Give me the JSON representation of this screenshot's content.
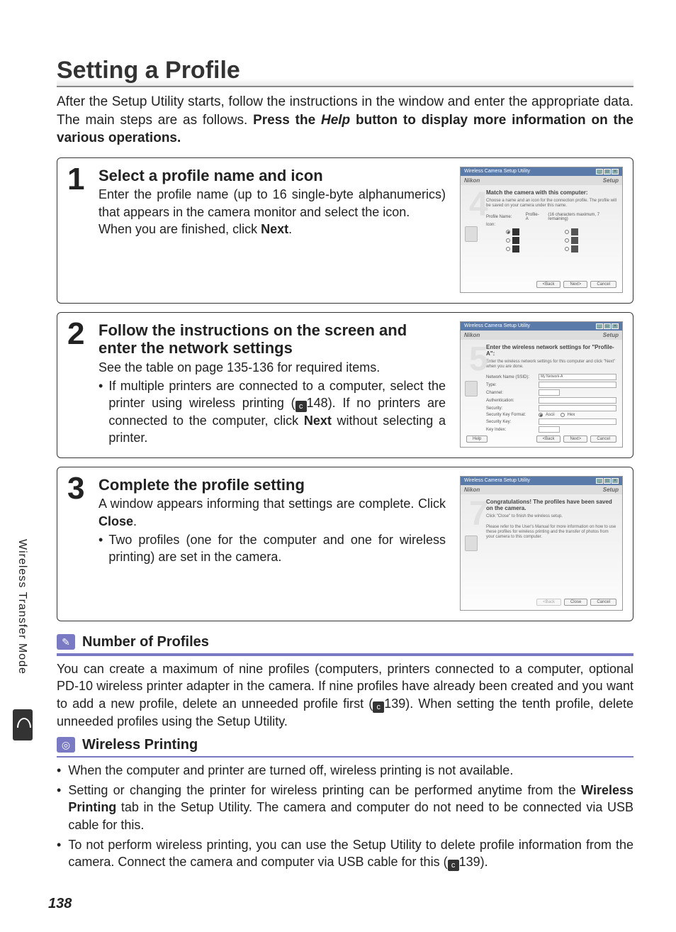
{
  "page_number": "138",
  "side_tab": "Wireless Transfer Mode",
  "heading": "Setting a Profile",
  "intro_parts": {
    "a": "After the Setup Utility starts, follow the instructions in the window and enter the appropriate data. The main steps are as follows. ",
    "b": "Press the ",
    "c": "Help",
    "d": " button to display more information on the various operations."
  },
  "steps": [
    {
      "num": "1",
      "title": "Select a profile name and icon",
      "body_a": "Enter the profile name (up to 16 single-byte alphanumerics) that appears in the camera monitor and select the icon.",
      "body_b": "When you are finished, click ",
      "body_c": "Next",
      "body_d": ".",
      "shot": {
        "bignum": "4",
        "heading": "Match the camera with this computer:",
        "sub": "Choose a name and an icon for the connection profile. The profile will be saved on your camera under this name.",
        "profile_label": "Profile Name:",
        "profile_value": "Profile-A",
        "profile_hint": "(16 characters maximum, 7 remaining)",
        "icon_label": "Icon:",
        "btn_back": "<Back",
        "btn_next": "Next>",
        "btn_cancel": "Cancel"
      }
    },
    {
      "num": "2",
      "title": "Follow the instructions on the screen and enter the network settings",
      "body_a": "See the table on page 135-136 for required items.",
      "bullet_a": "If multiple printers are connected to a computer, select the printer using wireless printing (",
      "bullet_ref": "c",
      "bullet_pg": "148). If no printers are connected to the computer, click ",
      "bullet_b": "Next",
      "bullet_c": " without selecting a printer.",
      "shot": {
        "bignum": "5",
        "heading": "Enter the wireless network settings for \"Profile-A\":",
        "sub": "Enter the wireless network settings for this computer and click \"Next\" when you are done.",
        "rows": {
          "ssid_l": "Network Name (SSID):",
          "ssid_v": "My Network-A",
          "type_l": "Type:",
          "chan_l": "Channel:",
          "auth_l": "Authentication:",
          "sec_l": "Security:",
          "fmt_l": "Security Key Format:",
          "fmt_a": "Ascii",
          "fmt_b": "Hex",
          "key_l": "Security Key:",
          "idx_l": "Key Index:"
        },
        "btn_help": "Help",
        "btn_back": "<Back",
        "btn_next": "Next>",
        "btn_cancel": "Cancel"
      }
    },
    {
      "num": "3",
      "title": "Complete the profile setting",
      "body_a": "A window appears informing that settings are complete. Click ",
      "body_b": "Close",
      "body_c": ".",
      "bullet": "Two profiles (one for the computer and one for wireless printing) are set in the camera.",
      "shot": {
        "bignum": "7",
        "heading": "Congratulations! The profiles have been saved on the camera.",
        "sub1": "Click \"Close\" to finish the wireless setup.",
        "sub2": "Please refer to the User's Manual for more information on how to use these profiles for wireless printing and the transfer of photos from your camera to this computer.",
        "btn_back": "<Back",
        "btn_close": "Close",
        "btn_cancel": "Cancel"
      }
    }
  ],
  "shot_common": {
    "title": "Wireless Camera Setup Utility",
    "brand": "Nikon",
    "brand_r": "Setup"
  },
  "notes": {
    "profiles": {
      "title": "Number of Profiles",
      "body_a": "You can create a maximum of nine profiles (computers, printers connected to a computer, optional PD-10 wireless printer adapter in the camera. If nine profiles have already been created and you want to add a new profile, delete an unneeded profile first (",
      "ref": "c",
      "body_b": "139). When setting the tenth profile, delete unneeded profiles using the Setup Utility."
    },
    "printing": {
      "title": "Wireless Printing",
      "bullets": [
        {
          "t": "When the computer and printer are turned off, wireless printing is not available."
        },
        {
          "a": "Setting or changing the printer for wireless printing can be performed anytime from the ",
          "b": "Wireless Printing",
          "c": " tab in the Setup Utility. The camera and computer do not need to be connected via USB cable for this."
        },
        {
          "a": "To not perform wireless printing, you can use the Setup Utility to delete profile information from the camera. Connect the camera and computer via USB cable for this (",
          "ref": "c",
          "b": "139)."
        }
      ]
    }
  }
}
